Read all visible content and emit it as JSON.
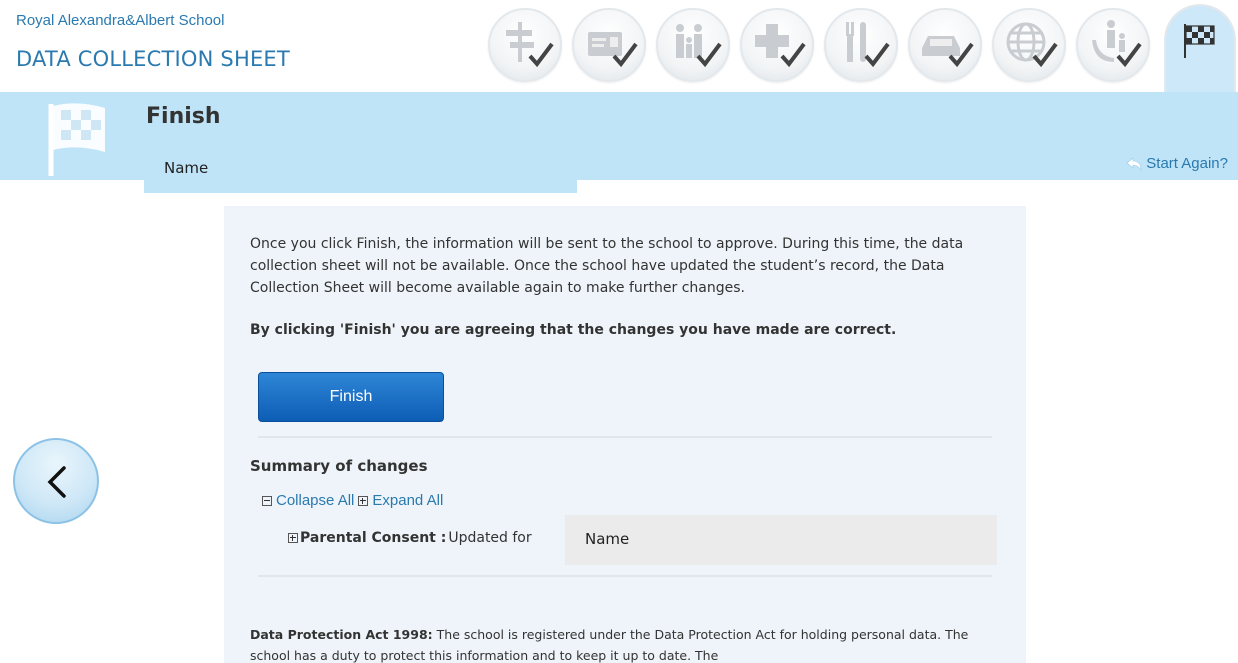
{
  "header": {
    "school_name": "Royal Alexandra&Albert School",
    "sheet_title": "DATA COLLECTION SHEET"
  },
  "steps": [
    {
      "icon": "signpost-icon",
      "completed": true
    },
    {
      "icon": "id-card-icon",
      "completed": true
    },
    {
      "icon": "family-icon",
      "completed": true
    },
    {
      "icon": "medical-cross-icon",
      "completed": true
    },
    {
      "icon": "fork-knife-icon",
      "completed": true
    },
    {
      "icon": "car-icon",
      "completed": true
    },
    {
      "icon": "globe-icon",
      "completed": true
    },
    {
      "icon": "parent-child-icon",
      "completed": true
    },
    {
      "icon": "checkered-flag-icon",
      "active": true
    }
  ],
  "band": {
    "heading": "Finish",
    "name_placeholder": "Name",
    "start_again": "Start Again?"
  },
  "main": {
    "intro": "Once you click Finish, the information will be sent to the school to approve. During this time, the data collection sheet will not be available. Once the school have updated the student’s record, the Data Collection Sheet will become available again to make further changes.",
    "agree": "By clicking 'Finish' you are agreeing that the changes you have made are correct.",
    "finish_button": "Finish",
    "summary_title": "Summary of changes",
    "collapse_all": "Collapse All",
    "expand_all": "Expand All",
    "tree_item": {
      "label": "Parental Consent :",
      "text": "Updated for",
      "name": "Name"
    },
    "dpa_label": "Data Protection Act 1998:",
    "dpa_text": "The school is registered under the Data Protection Act for holding personal data. The school has a duty to protect this information and to keep it up to date. The"
  },
  "colors": {
    "accent": "#2a7ab0",
    "band": "#bfe3f7",
    "panel": "#eef4f9",
    "button": "#0d5db5"
  }
}
